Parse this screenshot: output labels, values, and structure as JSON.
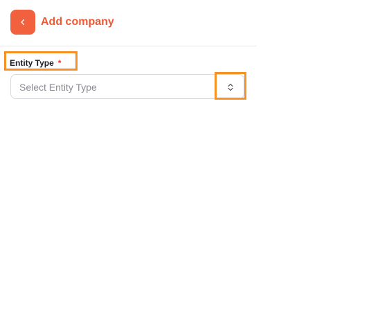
{
  "header": {
    "back_icon": "chevron-left-icon",
    "title": "Add company"
  },
  "form": {
    "entity_type": {
      "label": "Entity Type",
      "required_mark": "*",
      "placeholder": "Select Entity Type",
      "value": "",
      "icon": "chevron-up-down-icon"
    }
  },
  "colors": {
    "accent": "#f2613d",
    "title": "#ef5a35",
    "required": "#e53935",
    "highlight": "#f59125",
    "placeholder": "#8d8d96",
    "border": "#d9d9de"
  }
}
